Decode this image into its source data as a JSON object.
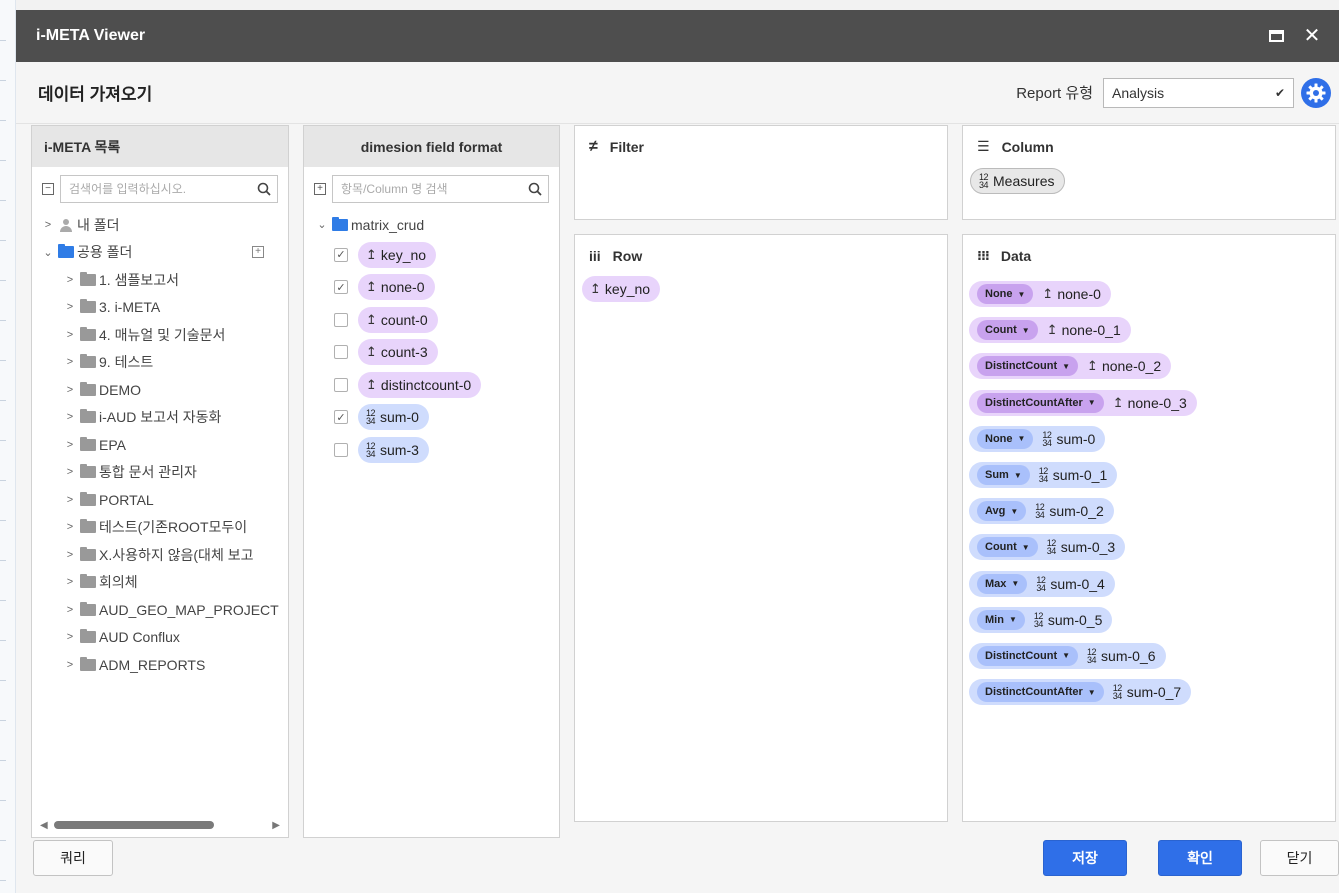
{
  "window": {
    "title": "i-META Viewer"
  },
  "header": {
    "title": "데이터 가져오기",
    "report_type_label": "Report 유형",
    "report_type_value": "Analysis"
  },
  "meta_panel": {
    "title": "i-META 목록",
    "search_placeholder": "검색어를 입력하십시오.",
    "tree": [
      {
        "label": "내 폴더",
        "expanded": false,
        "icon": "user-icon",
        "level": 0
      },
      {
        "label": "공용 폴더",
        "expanded": true,
        "icon": "folder-blue-icon",
        "level": 0
      },
      {
        "label": "1. 샘플보고서",
        "level": 1
      },
      {
        "label": "3. i-META",
        "level": 1
      },
      {
        "label": "4. 매뉴얼 및 기술문서",
        "level": 1
      },
      {
        "label": "9. 테스트",
        "level": 1
      },
      {
        "label": "DEMO",
        "level": 1
      },
      {
        "label": "i-AUD 보고서 자동화",
        "level": 1
      },
      {
        "label": "EPA",
        "level": 1
      },
      {
        "label": "통합 문서 관리자",
        "level": 1
      },
      {
        "label": "PORTAL",
        "level": 1
      },
      {
        "label": "테스트(기존ROOT모두이",
        "level": 1
      },
      {
        "label": "X.사용하지 않음(대체 보고",
        "level": 1
      },
      {
        "label": "회의체",
        "level": 1
      },
      {
        "label": "AUD_GEO_MAP_PROJECT",
        "level": 1
      },
      {
        "label": "AUD Conflux",
        "level": 1
      },
      {
        "label": "ADM_REPORTS",
        "level": 1
      }
    ]
  },
  "field_panel": {
    "title": "dimesion field format",
    "search_placeholder": "항목/Column 명 검색",
    "root": "matrix_crud",
    "fields": [
      {
        "label": "key_no",
        "checked": true,
        "kind": "dimension"
      },
      {
        "label": "none-0",
        "checked": true,
        "kind": "dimension"
      },
      {
        "label": "count-0",
        "checked": false,
        "kind": "dimension"
      },
      {
        "label": "count-3",
        "checked": false,
        "kind": "dimension"
      },
      {
        "label": "distinctcount-0",
        "checked": false,
        "kind": "dimension"
      },
      {
        "label": "sum-0",
        "checked": true,
        "kind": "measure"
      },
      {
        "label": "sum-3",
        "checked": false,
        "kind": "measure"
      }
    ]
  },
  "filter": {
    "title": "Filter"
  },
  "column": {
    "title": "Column",
    "items": [
      {
        "label": "Measures"
      }
    ]
  },
  "row": {
    "title": "Row",
    "items": [
      {
        "label": "key_no"
      }
    ]
  },
  "data": {
    "title": "Data",
    "items": [
      {
        "agg": "None",
        "label": "none-0",
        "kind": "dimension"
      },
      {
        "agg": "Count",
        "label": "none-0_1",
        "kind": "dimension"
      },
      {
        "agg": "DistinctCount",
        "label": "none-0_2",
        "kind": "dimension"
      },
      {
        "agg": "DistinctCountAfter",
        "label": "none-0_3",
        "kind": "dimension"
      },
      {
        "agg": "None",
        "label": "sum-0",
        "kind": "measure"
      },
      {
        "agg": "Sum",
        "label": "sum-0_1",
        "kind": "measure"
      },
      {
        "agg": "Avg",
        "label": "sum-0_2",
        "kind": "measure"
      },
      {
        "agg": "Count",
        "label": "sum-0_3",
        "kind": "measure"
      },
      {
        "agg": "Max",
        "label": "sum-0_4",
        "kind": "measure"
      },
      {
        "agg": "Min",
        "label": "sum-0_5",
        "kind": "measure"
      },
      {
        "agg": "DistinctCount",
        "label": "sum-0_6",
        "kind": "measure"
      },
      {
        "agg": "DistinctCountAfter",
        "label": "sum-0_7",
        "kind": "measure"
      }
    ]
  },
  "footer": {
    "query_label": "쿼리",
    "save_label": "저장",
    "ok_label": "확인",
    "close_label": "닫기"
  },
  "icons": {
    "dimension": "↥",
    "measure_top": "12",
    "measure_bottom": "34"
  },
  "colors": {
    "accent": "#2f6fe8",
    "dimension_chip": "#e8d4fb",
    "measure_chip": "#cfdcfd",
    "titlebar": "#4e4e4e"
  }
}
